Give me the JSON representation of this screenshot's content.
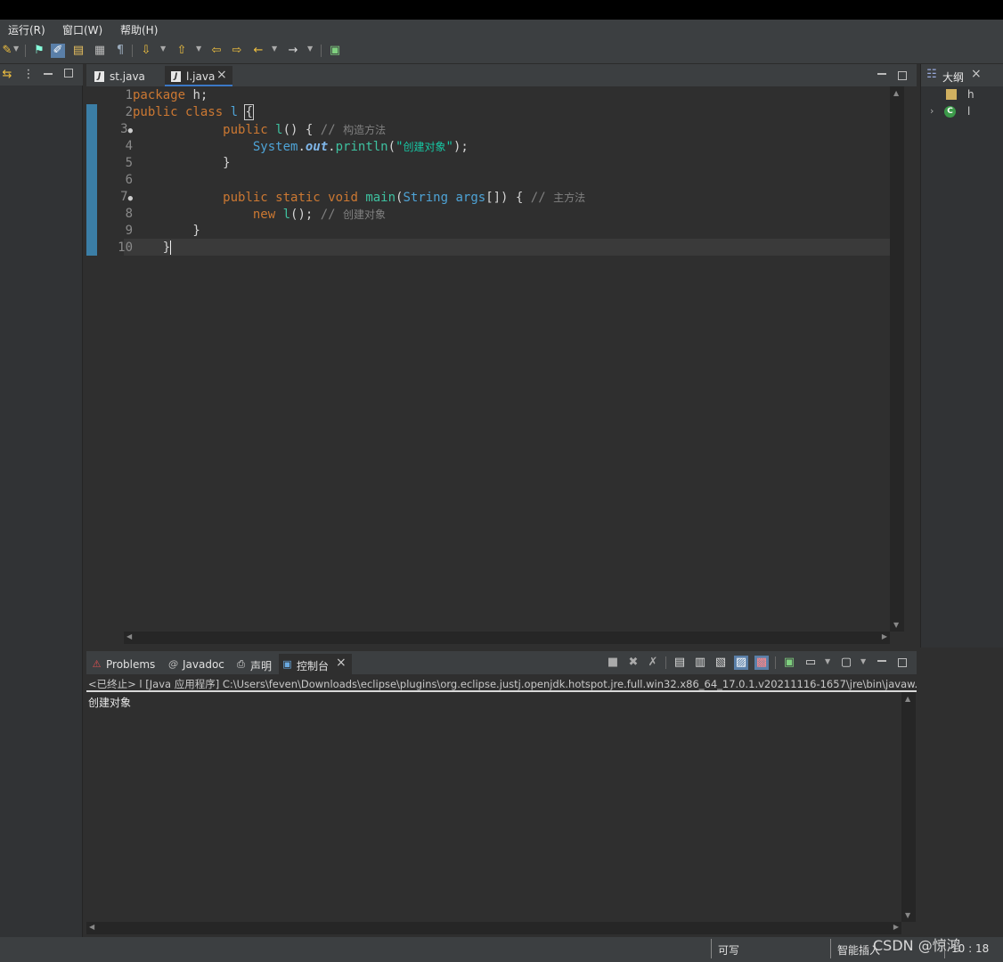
{
  "menu": {
    "items": [
      "运行(R)",
      "窗口(W)",
      "帮助(H)"
    ]
  },
  "editor": {
    "tabs": [
      {
        "label": "st.java",
        "active": false
      },
      {
        "label": "l.java",
        "active": true
      }
    ],
    "line_numbers": [
      "1",
      "2",
      "3",
      "4",
      "5",
      "6",
      "7",
      "8",
      "9",
      "10"
    ],
    "fold_markers": [
      "3",
      "7"
    ]
  },
  "outline": {
    "title": "大纲",
    "items": [
      {
        "label": "h",
        "icon": "package-icon"
      },
      {
        "label": "l",
        "icon": "class-icon"
      }
    ]
  },
  "console": {
    "tabs": [
      {
        "label": "Problems",
        "icon": "problems-icon"
      },
      {
        "label": "Javadoc",
        "icon": "at-icon"
      },
      {
        "label": "声明",
        "icon": "declaration-icon"
      },
      {
        "label": "控制台",
        "icon": "console-icon",
        "active": true
      }
    ],
    "path": "<已终止> l [Java 应用程序] C:\\Users\\feven\\Downloads\\eclipse\\plugins\\org.eclipse.justj.openjdk.hotspot.jre.full.win32.x86_64_17.0.1.v20211116-1657\\jre\\bin\\javaw.",
    "output": "创建对象"
  },
  "status": {
    "writable": "可写",
    "insert_mode": "智能插入",
    "position": "10 : 18"
  },
  "watermark": "CSDN @惊鸿",
  "colors": {
    "keyword": "#cc7832",
    "type": "#4ea3d6",
    "string": "#17c6a3",
    "comment": "#808080",
    "accent": "#3b78c6"
  }
}
